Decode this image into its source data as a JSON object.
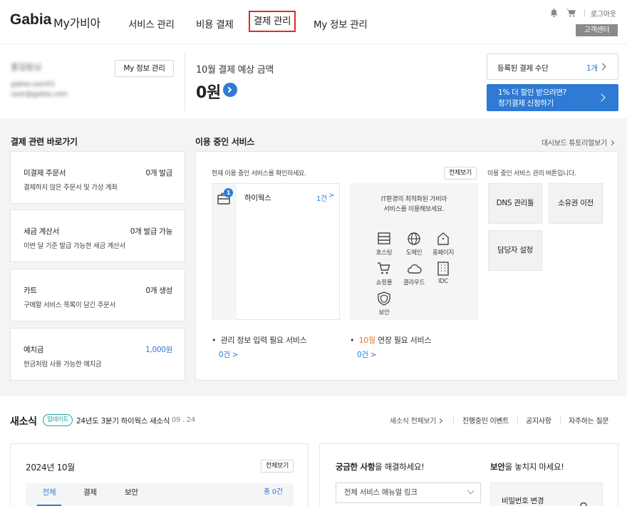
{
  "header": {
    "logo": "Gabia",
    "brand": "My가비아",
    "nav": [
      "서비스 관리",
      "비용 결제",
      "결제 관리",
      "My 정보 관리"
    ],
    "logout": "로그아웃",
    "customer_center": "고객센터"
  },
  "profile": {
    "name": "홍길동님",
    "line1": "gabia-user01",
    "line2": "user@gabia.com",
    "button": "My 정보 관리"
  },
  "payment": {
    "title": "10월 결제 예상 금액",
    "amount": "0원"
  },
  "methods": {
    "label": "등록된 결제 수단",
    "count": "1개",
    "promo_line1": "1% 더 할인 받으려면?",
    "promo_line2": "정기결제 신청하기"
  },
  "shortcuts": {
    "title": "결제 관련 바로가기",
    "items": [
      {
        "title": "미결제 주문서",
        "value": "0개 발급",
        "desc": "결제하지 않은 주문서 및 가상 계좌",
        "color": "#222"
      },
      {
        "title": "세금 계산서",
        "value": "0개 발급 가능",
        "desc": "이번 달 기준 발급 가능한 세금 계산서",
        "color": "#222"
      },
      {
        "title": "카트",
        "value": "0개 생성",
        "desc": "구매할 서비스 목록이 담긴 주문서",
        "color": "#222"
      },
      {
        "title": "예치금",
        "value": "1,000원",
        "desc": "현금처럼 사용 가능한 예치금",
        "color": "#2f7bd3"
      }
    ]
  },
  "services": {
    "title": "이용 중인 서비스",
    "tutorial": "대시보드 튜토리얼보기",
    "desc": "현재 이용 중인 서비스를 확인하세요.",
    "view_all": "전체보기",
    "item_name": "하이웍스",
    "item_count": "1건",
    "badge": "1",
    "promo_line1": "IT환경의 최적화된 가비아",
    "promo_line2": "서비스를 이용해보세요.",
    "promo_items": [
      {
        "label": "호스팅",
        "icon": "hosting-icon"
      },
      {
        "label": "도메인",
        "icon": "globe-icon"
      },
      {
        "label": "홈페이지",
        "icon": "home-icon"
      },
      {
        "label": "쇼핑몰",
        "icon": "cart-icon"
      },
      {
        "label": "클라우드",
        "icon": "cloud-icon"
      },
      {
        "label": "IDC",
        "icon": "server-icon"
      },
      {
        "label": "보안",
        "icon": "shield-icon"
      }
    ],
    "mgmt_desc": "이용 중인 서비스 관리 버튼입니다.",
    "mgmt_buttons": [
      "DNS 관리툴",
      "소유권 이전",
      "담당자 설정"
    ],
    "needs_info": "관리 정보 입력 필요 서비스",
    "needs_info_count": "0건",
    "renew_month": "10월",
    "renew_text": " 연장 필요 서비스",
    "renew_count": "0건"
  },
  "news": {
    "title": "새소식",
    "badge": "업데이트",
    "headline": "24년도 3분기 하이웍스 새소식",
    "date": "09 . 24",
    "links": [
      "새소식 전체보기",
      "진행중인 이벤트",
      "공지사항",
      "자주하는 질문"
    ]
  },
  "calendar": {
    "month": "2024년 10월",
    "view_all": "전체보기",
    "tabs": [
      "전체",
      "결제",
      "보안"
    ],
    "total": "총 0건"
  },
  "help": {
    "title_bold": "궁금한 사항",
    "title_rest": "을 해결하세요!",
    "select": "전체 서비스 매뉴얼 링크"
  },
  "security": {
    "title_bold": "보안",
    "title_rest": "을 놓치지 마세요!",
    "item": "비밀번호 변경"
  }
}
